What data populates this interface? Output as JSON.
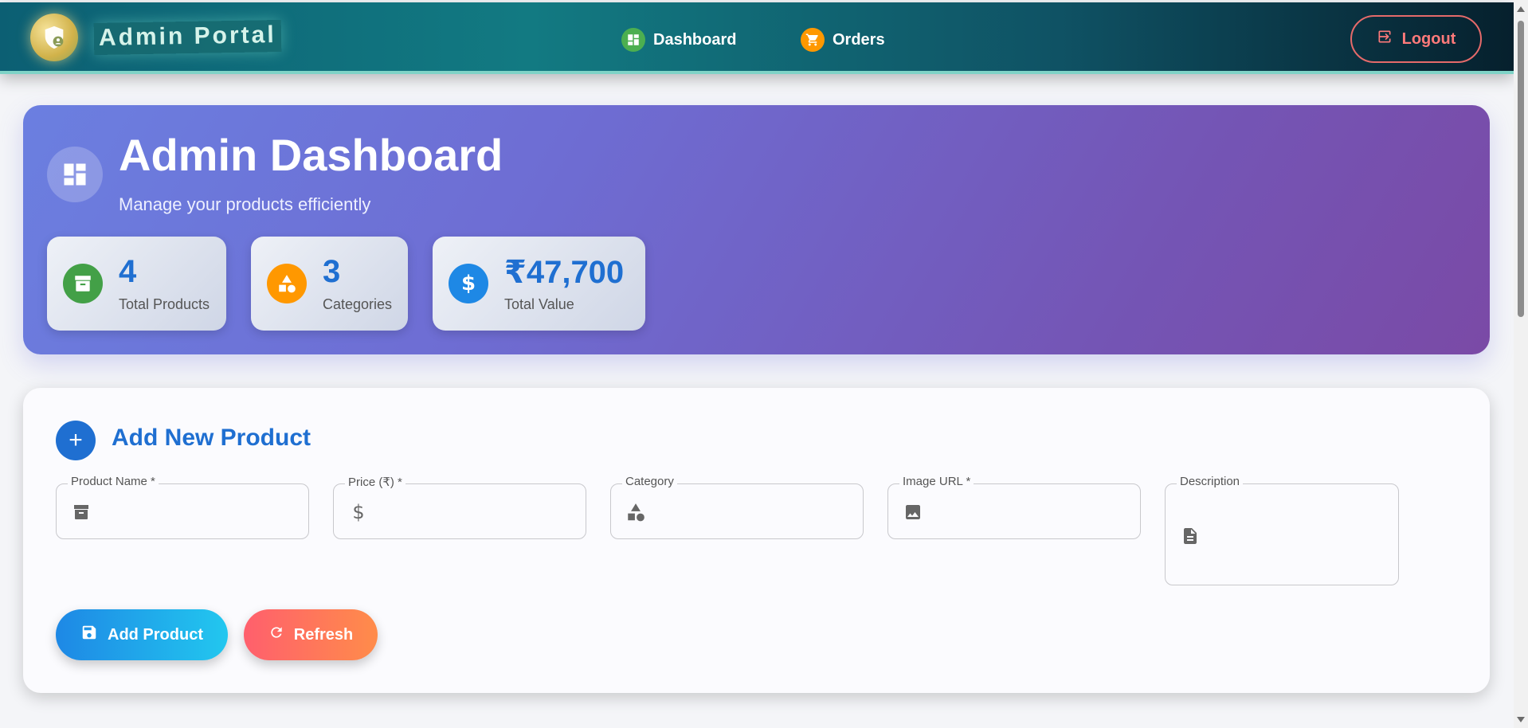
{
  "nav": {
    "brand": "Admin Portal",
    "links": [
      {
        "label": "Dashboard",
        "icon": "dashboard-icon",
        "color": "#4caf50"
      },
      {
        "label": "Orders",
        "icon": "cart-icon",
        "color": "#ff9800"
      }
    ],
    "logout_label": "Logout"
  },
  "hero": {
    "title": "Admin Dashboard",
    "subtitle": "Manage your products efficiently",
    "stats": [
      {
        "value": "4",
        "label": "Total Products",
        "icon": "archive-icon",
        "color": "#43a047"
      },
      {
        "value": "3",
        "label": "Categories",
        "icon": "category-icon",
        "color": "#ff9800"
      },
      {
        "value": "₹47,700",
        "label": "Total Value",
        "icon": "dollar-icon",
        "color": "#1e88e5"
      }
    ]
  },
  "form": {
    "title": "Add New Product",
    "fields": [
      {
        "label": "Product Name *",
        "icon": "archive-icon",
        "value": ""
      },
      {
        "label": "Price (₹) *",
        "icon": "dollar-icon",
        "value": ""
      },
      {
        "label": "Category",
        "icon": "category-icon",
        "value": ""
      },
      {
        "label": "Image URL *",
        "icon": "image-icon",
        "value": ""
      },
      {
        "label": "Description",
        "icon": "document-icon",
        "value": ""
      }
    ],
    "add_label": "Add Product",
    "refresh_label": "Refresh"
  },
  "colors": {
    "accent": "#1f6fd1",
    "logout": "#e56a6a"
  }
}
